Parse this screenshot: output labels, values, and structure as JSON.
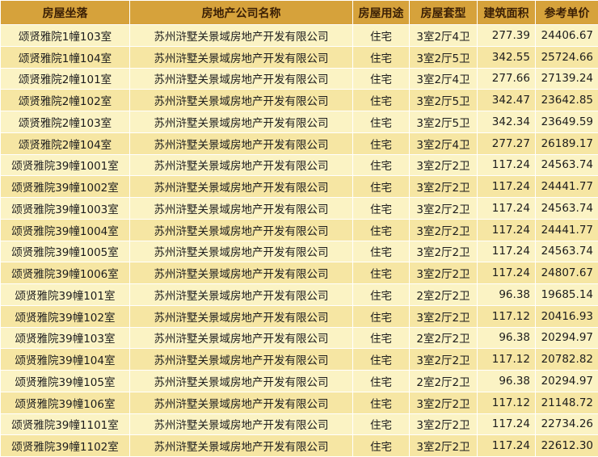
{
  "table": {
    "headers": [
      "房屋坐落",
      "房地产公司名称",
      "房屋用途",
      "房屋套型",
      "建筑面积",
      "参考单价"
    ],
    "rows": [
      [
        "颂贤雅院1幢103室",
        "苏州浒墅关景域房地产开发有限公司",
        "住宅",
        "3室2厅4卫",
        "277.39",
        "24406.67"
      ],
      [
        "颂贤雅院1幢104室",
        "苏州浒墅关景域房地产开发有限公司",
        "住宅",
        "3室2厅5卫",
        "342.55",
        "25724.66"
      ],
      [
        "颂贤雅院2幢101室",
        "苏州浒墅关景域房地产开发有限公司",
        "住宅",
        "3室2厅4卫",
        "277.66",
        "27139.24"
      ],
      [
        "颂贤雅院2幢102室",
        "苏州浒墅关景域房地产开发有限公司",
        "住宅",
        "3室2厅5卫",
        "342.47",
        "23642.85"
      ],
      [
        "颂贤雅院2幢103室",
        "苏州浒墅关景域房地产开发有限公司",
        "住宅",
        "3室2厅5卫",
        "342.34",
        "23649.59"
      ],
      [
        "颂贤雅院2幢104室",
        "苏州浒墅关景域房地产开发有限公司",
        "住宅",
        "3室2厅4卫",
        "277.27",
        "26189.17"
      ],
      [
        "颂贤雅院39幢1001室",
        "苏州浒墅关景域房地产开发有限公司",
        "住宅",
        "3室2厅2卫",
        "117.24",
        "24563.74"
      ],
      [
        "颂贤雅院39幢1002室",
        "苏州浒墅关景域房地产开发有限公司",
        "住宅",
        "3室2厅2卫",
        "117.24",
        "24441.77"
      ],
      [
        "颂贤雅院39幢1003室",
        "苏州浒墅关景域房地产开发有限公司",
        "住宅",
        "3室2厅2卫",
        "117.24",
        "24563.74"
      ],
      [
        "颂贤雅院39幢1004室",
        "苏州浒墅关景域房地产开发有限公司",
        "住宅",
        "3室2厅2卫",
        "117.24",
        "24441.77"
      ],
      [
        "颂贤雅院39幢1005室",
        "苏州浒墅关景域房地产开发有限公司",
        "住宅",
        "3室2厅2卫",
        "117.24",
        "24563.74"
      ],
      [
        "颂贤雅院39幢1006室",
        "苏州浒墅关景域房地产开发有限公司",
        "住宅",
        "3室2厅2卫",
        "117.24",
        "24807.67"
      ],
      [
        "颂贤雅院39幢101室",
        "苏州浒墅关景域房地产开发有限公司",
        "住宅",
        "2室2厅2卫",
        "96.38",
        "19685.14"
      ],
      [
        "颂贤雅院39幢102室",
        "苏州浒墅关景域房地产开发有限公司",
        "住宅",
        "3室2厅2卫",
        "117.12",
        "20416.93"
      ],
      [
        "颂贤雅院39幢103室",
        "苏州浒墅关景域房地产开发有限公司",
        "住宅",
        "2室2厅2卫",
        "96.38",
        "20294.97"
      ],
      [
        "颂贤雅院39幢104室",
        "苏州浒墅关景域房地产开发有限公司",
        "住宅",
        "3室2厅2卫",
        "117.12",
        "20782.82"
      ],
      [
        "颂贤雅院39幢105室",
        "苏州浒墅关景域房地产开发有限公司",
        "住宅",
        "2室2厅2卫",
        "96.38",
        "20294.97"
      ],
      [
        "颂贤雅院39幢106室",
        "苏州浒墅关景域房地产开发有限公司",
        "住宅",
        "3室2厅2卫",
        "117.12",
        "21148.72"
      ],
      [
        "颂贤雅院39幢1101室",
        "苏州浒墅关景域房地产开发有限公司",
        "住宅",
        "3室2厅2卫",
        "117.24",
        "22734.26"
      ],
      [
        "颂贤雅院39幢1102室",
        "苏州浒墅关景域房地产开发有限公司",
        "住宅",
        "3室2厅2卫",
        "117.24",
        "22612.30"
      ]
    ]
  },
  "colors": {
    "header_bg": "#d6a23b",
    "row_odd_bg": "#fbf3c4",
    "row_even_bg": "#f6e6a3"
  }
}
